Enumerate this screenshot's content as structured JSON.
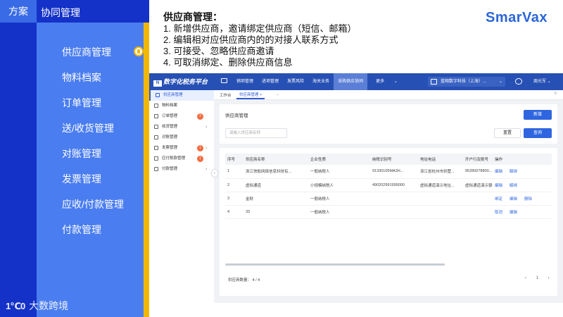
{
  "slide": {
    "tab_fangan": "方案",
    "tab_xietong": "协同管理",
    "nav": [
      "供应商管理",
      "物料档案",
      "订单管理",
      "送/收货管理",
      "对账管理",
      "发票管理",
      "应收/付款管理",
      "付款管理"
    ],
    "active_index": 0,
    "brand": "大数跨境",
    "brand_mark": "1℃0",
    "logo": "SmarVax"
  },
  "description": {
    "title": "供应商管理：",
    "lines": [
      "1. 新增供应商，邀请绑定供应商（短信、邮箱）",
      "2. 编辑相对应供应商内的的对接人联系方式",
      "3. 可接受、忽略供应商邀请",
      "4. 可取消绑定、删除供应商信息"
    ]
  },
  "app": {
    "platform_name": "数字化税务平台",
    "platform_icon": "N",
    "menu": [
      "销项管理",
      "进项管理",
      "发票风险",
      "海关业务",
      "采购供应协同",
      "更多"
    ],
    "menu_more_chevron": "⌄",
    "company": "蓝翔数字科技（上海）...",
    "company_chevron": "⌄",
    "user": "周光军 ⌄",
    "sidebar": [
      {
        "label": "供应商管理",
        "badge": "",
        "arrow": ""
      },
      {
        "label": "物料档案",
        "badge": "",
        "arrow": ""
      },
      {
        "label": "订单管理",
        "badge": "2",
        "arrow": ""
      },
      {
        "label": "收货管理",
        "badge": "",
        "arrow": "›"
      },
      {
        "label": "对账管理",
        "badge": "",
        "arrow": ""
      },
      {
        "label": "发票管理",
        "badge": "1",
        "arrow": "›"
      },
      {
        "label": "应付账款管理",
        "badge": "1",
        "arrow": ""
      },
      {
        "label": "付款管理",
        "badge": "",
        "arrow": "›"
      }
    ],
    "collapse_glyph": "‹",
    "tabs": {
      "workbench": "工作台",
      "current": "供应商管理 ×",
      "dropdown": "⌄",
      "refresh": "↻"
    },
    "page_title": "供应商管理",
    "new_button": "新增",
    "search_placeholder": "请输入供应商名称",
    "reset_button": "重置",
    "query_button": "查询",
    "table": {
      "headers": [
        "序号",
        "供应商名称",
        "企业性质",
        "纳税识别号",
        "地址电话",
        "开户行及账号",
        "操作"
      ],
      "rows": [
        [
          "1",
          "浙江快航网络信息科技有...",
          "一般纳税人",
          "91330105MA2H...",
          "浙江省杭州市拱墅...",
          "95280078800...",
          [
            "编辑",
            "解绑"
          ]
        ],
        [
          "2",
          "虚拟通道",
          "小规模纳税人",
          "490202991999000",
          "虚拟通道演示地址...",
          "虚拟通道演示银行...",
          [
            "编辑",
            "解绑"
          ]
        ],
        [
          "3",
          "金财",
          "一般纳税人",
          "",
          "",
          "",
          [
            "绑定",
            "编辑",
            "删除"
          ]
        ],
        [
          "4",
          "33",
          "一般纳税人",
          "",
          "",
          "",
          [
            "取消",
            "编辑"
          ]
        ]
      ]
    },
    "total_label": "供应商数量：  4 / 4",
    "pagination": "‹ 1 ›"
  },
  "colors": {
    "dark_blue": "#1432c8",
    "mid_blue": "#4a7df0",
    "yellow": "#f2b705",
    "app_topbar": "#2750b4",
    "primary_button": "#2f66e0"
  }
}
